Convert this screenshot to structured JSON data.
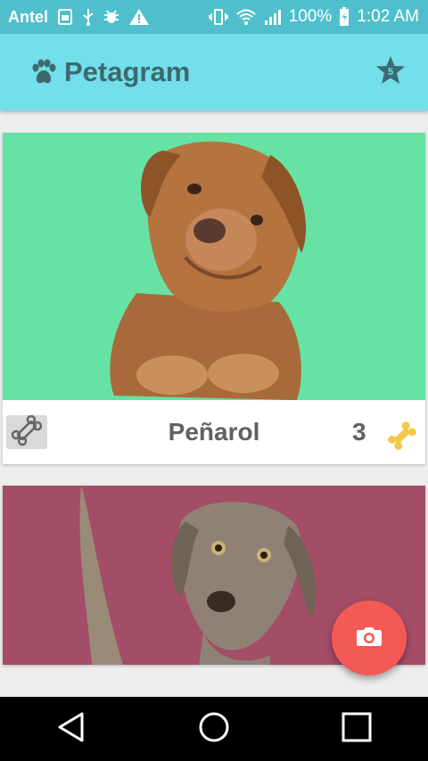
{
  "status_bar": {
    "carrier": "Antel",
    "battery_percent": "100%",
    "time": "1:02 AM",
    "icons": [
      "hd-voice-icon",
      "usb-icon",
      "bug-icon",
      "warning-icon",
      "vibrate-icon",
      "wifi-icon",
      "signal-icon",
      "battery-icon"
    ]
  },
  "appbar": {
    "title": "Petagram",
    "favorites_count": "5",
    "icons": [
      "paw-icon",
      "star-icon"
    ]
  },
  "pets": [
    {
      "name": "Peñarol",
      "likes": "3",
      "image_bg": "#66e2a5",
      "image": "dog-photo"
    },
    {
      "image_bg": "#a34d67",
      "image": "dog-photo"
    }
  ],
  "fab": {
    "icon": "camera-icon",
    "color": "#f45a55"
  },
  "navbar": {
    "icons": [
      "back-icon",
      "home-icon",
      "recents-icon"
    ]
  },
  "colors": {
    "status_bar": "#4fbfcc",
    "appbar": "#72dfea",
    "title": "#3c6a6f",
    "bone_like": "#f2c94c"
  }
}
